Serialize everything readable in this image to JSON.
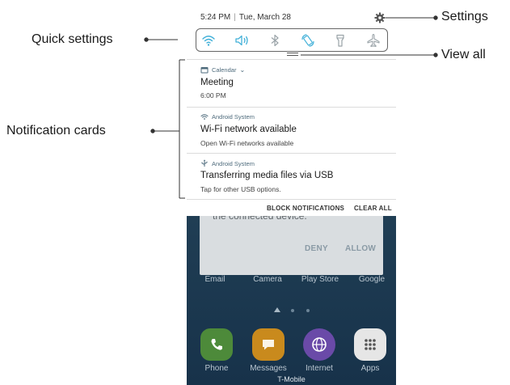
{
  "status_bar": {
    "time": "5:24 PM",
    "separator": "|",
    "date": "Tue, March 28"
  },
  "quick_settings": {
    "icons": [
      "wifi-icon",
      "sound-icon",
      "bluetooth-icon",
      "auto-rotate-icon",
      "flashlight-icon",
      "airplane-mode-icon"
    ],
    "active_color": "#41b0d8",
    "inactive_color": "#9aa3a8"
  },
  "notifications": [
    {
      "app": "Calendar",
      "icon": "calendar-icon",
      "title": "Meeting",
      "body": "6:00 PM"
    },
    {
      "app": "Android System",
      "icon": "wifi-icon",
      "title": "Wi-Fi network available",
      "body": "Open Wi-Fi networks available"
    },
    {
      "app": "Android System",
      "icon": "usb-icon",
      "title": "Transferring media files via USB",
      "body": "Tap for other USB options."
    }
  ],
  "actions": {
    "block": "BLOCK NOTIFICATIONS",
    "clear": "CLEAR ALL"
  },
  "background_dialog": {
    "text": "the connected device.",
    "deny": "DENY",
    "allow": "ALLOW"
  },
  "home_screen": {
    "row1_labels": [
      "Email",
      "Camera",
      "Play Store",
      "Google"
    ],
    "dock": [
      {
        "label": "Phone",
        "color": "#4d8a3a"
      },
      {
        "label": "Messages",
        "color": "#c98a1d"
      },
      {
        "label": "Internet",
        "color": "#6a4aa8"
      },
      {
        "label": "Apps",
        "color": "#e6e6e6"
      }
    ],
    "carrier": "T-Mobile"
  },
  "callouts": {
    "settings": "Settings",
    "quick_settings": "Quick settings",
    "view_all": "View all",
    "notification_cards": "Notification cards"
  }
}
